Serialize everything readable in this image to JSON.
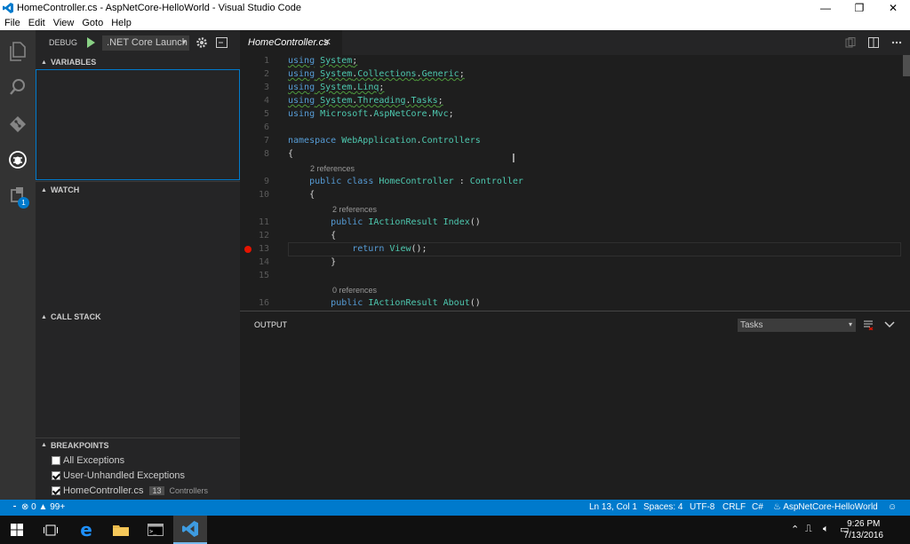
{
  "window": {
    "title": "HomeController.cs - AspNetCore-HelloWorld - Visual Studio Code",
    "minimize": "—",
    "restore": "❐",
    "close": "✕"
  },
  "menu": [
    "File",
    "Edit",
    "View",
    "Goto",
    "Help"
  ],
  "activity_bar": {
    "items": [
      "explorer-icon",
      "search-icon",
      "git-icon",
      "debug-icon",
      "extensions-icon"
    ],
    "extensions_badge": "1"
  },
  "debug": {
    "label": "DEBUG",
    "configuration": ".NET Core Launch",
    "caret": "▾"
  },
  "sidebar": {
    "variables": "VARIABLES",
    "watch": "WATCH",
    "call_stack": "CALL STACK",
    "breakpoints": "BREAKPOINTS",
    "breakpoint_items": [
      {
        "label": "All Exceptions",
        "checked": false
      },
      {
        "label": "User-Unhandled Exceptions",
        "checked": true
      },
      {
        "label": "HomeController.cs",
        "checked": true,
        "line": "13",
        "path": "Controllers"
      }
    ]
  },
  "tab": {
    "filename": "HomeController.cs",
    "close": "✕"
  },
  "editor": {
    "current_line": 13,
    "breakpoint_line": 13,
    "lines": [
      {
        "n": "1",
        "code": "using System;"
      },
      {
        "n": "2",
        "code": "using System.Collections.Generic;"
      },
      {
        "n": "3",
        "code": "using System.Linq;"
      },
      {
        "n": "4",
        "code": "using System.Threading.Tasks;"
      },
      {
        "n": "5",
        "code": "using Microsoft.AspNetCore.Mvc;"
      },
      {
        "n": "6",
        "code": ""
      },
      {
        "n": "7",
        "code": "namespace WebApplication.Controllers"
      },
      {
        "n": "8",
        "code": "{"
      },
      {
        "lens": "2 references"
      },
      {
        "n": "9",
        "code": "    public class HomeController : Controller"
      },
      {
        "n": "10",
        "code": "    {"
      },
      {
        "lens": "2 references"
      },
      {
        "n": "11",
        "code": "        public IActionResult Index()"
      },
      {
        "n": "12",
        "code": "        {"
      },
      {
        "n": "13",
        "code": "            return View();"
      },
      {
        "n": "14",
        "code": "        }"
      },
      {
        "n": "15",
        "code": ""
      },
      {
        "lens": "0 references"
      },
      {
        "n": "16",
        "code": "        public IActionResult About()"
      }
    ]
  },
  "panel": {
    "title": "OUTPUT",
    "channel": "Tasks",
    "caret": "▾"
  },
  "status": {
    "errors": "0",
    "warnings": "99+",
    "position": "Ln 13, Col 1",
    "spaces": "Spaces: 4",
    "encoding": "UTF-8",
    "eol": "CRLF",
    "language": "C#",
    "project": "AspNetCore-HelloWorld"
  },
  "taskbar": {
    "time": "9:26 PM",
    "date": "7/13/2016"
  },
  "colors": {
    "accent": "#007acc",
    "breakpoint": "#e51400",
    "keyword": "#569cd6",
    "type": "#4ec9b0"
  }
}
